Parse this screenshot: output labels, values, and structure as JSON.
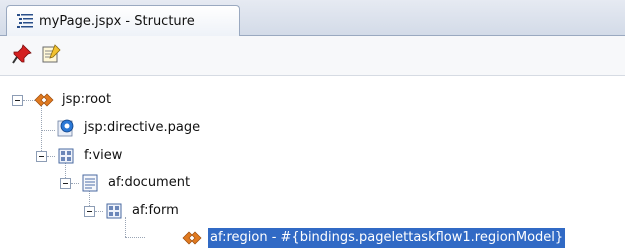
{
  "panel": {
    "tab_title": "myPage.jspx - Structure"
  },
  "toolbar": {
    "pin_icon": "pin-icon",
    "edit_icon": "edit-note-icon"
  },
  "tree": {
    "nodes": [
      {
        "label": "jsp:root",
        "icon": "jsp-tag-icon"
      },
      {
        "label": "jsp:directive.page",
        "icon": "directive-icon"
      },
      {
        "label": "f:view",
        "icon": "component-icon"
      },
      {
        "label": "af:document",
        "icon": "document-icon"
      },
      {
        "label": "af:form",
        "icon": "component-icon"
      },
      {
        "label": "af:region - #{bindings.pagelettaskflow1.regionModel}",
        "icon": "jsp-tag-icon",
        "selected": true
      }
    ]
  },
  "colors": {
    "selection": "#316ac5",
    "tag_orange": "#e07a20"
  }
}
